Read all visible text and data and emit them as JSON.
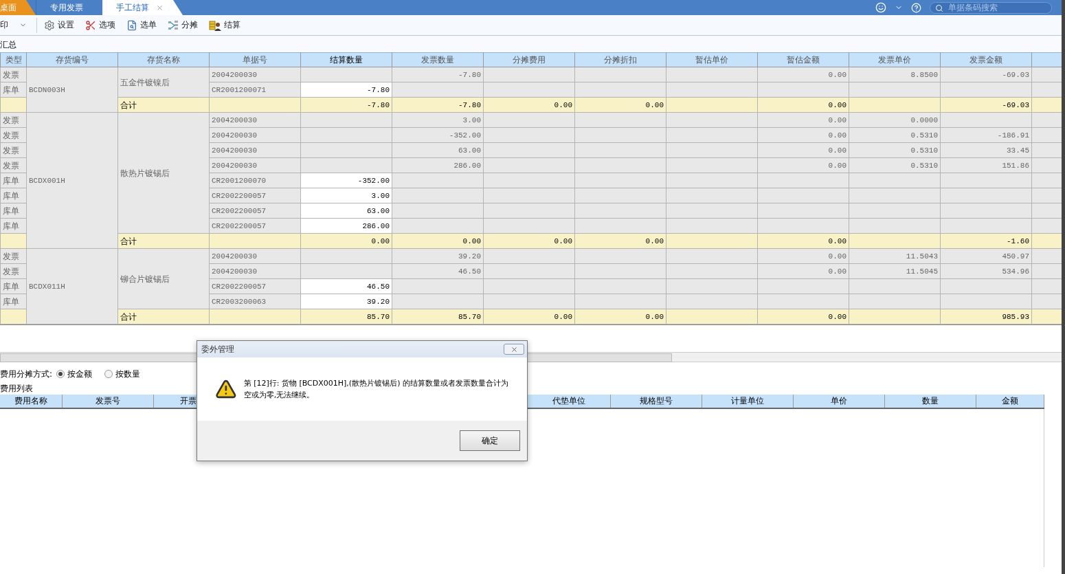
{
  "tabs": [
    {
      "label": "桌面",
      "kind": "home",
      "selected": false
    },
    {
      "label": "专用发票",
      "kind": "doc",
      "selected": false
    },
    {
      "label": "手工结算",
      "kind": "doc",
      "selected": true
    }
  ],
  "search": {
    "placeholder": "单据条码搜索"
  },
  "toolbar": [
    {
      "label": "印",
      "kind": "print"
    },
    {
      "label": "设置",
      "kind": "gear"
    },
    {
      "label": "选项",
      "kind": "tools"
    },
    {
      "label": "选单",
      "kind": "pick"
    },
    {
      "label": "分摊",
      "kind": "split"
    },
    {
      "label": "结算",
      "kind": "settle"
    }
  ],
  "section_title": "汇总",
  "grid": {
    "columns": [
      {
        "label": "类型",
        "editable": false
      },
      {
        "label": "存货编号",
        "editable": false
      },
      {
        "label": "存货名称",
        "editable": false
      },
      {
        "label": "单据号",
        "editable": false
      },
      {
        "label": "结算数量",
        "editable": true
      },
      {
        "label": "发票数量",
        "editable": false
      },
      {
        "label": "分摊费用",
        "editable": false
      },
      {
        "label": "分摊折扣",
        "editable": false
      },
      {
        "label": "暂估单价",
        "editable": false
      },
      {
        "label": "暂估金额",
        "editable": false
      },
      {
        "label": "发票单价",
        "editable": false
      },
      {
        "label": "发票金额",
        "editable": false
      }
    ],
    "groups": [
      {
        "code": "BCDN003H",
        "name": "五金件镀镍后",
        "rows": [
          {
            "kind": "invoice",
            "type": "发票",
            "doc": "2004200030",
            "cells": [
              null,
              "-7.80",
              null,
              null,
              null,
              "0.00",
              "8.8500",
              "-69.03"
            ]
          },
          {
            "kind": "receipt",
            "type": "库单",
            "doc": "CR2001200071",
            "cells": [
              "-7.80",
              null,
              null,
              null,
              null,
              null,
              null,
              null
            ]
          }
        ],
        "total": {
          "label": "合计",
          "cells": [
            "-7.80",
            "-7.80",
            "0.00",
            "0.00",
            null,
            "0.00",
            null,
            "-69.03"
          ]
        }
      },
      {
        "code": "BCDX001H",
        "name": "散热片镀锡后",
        "rows": [
          {
            "kind": "invoice",
            "type": "发票",
            "doc": "2004200030",
            "cells": [
              null,
              "3.00",
              null,
              null,
              null,
              "0.00",
              "0.0000",
              null
            ]
          },
          {
            "kind": "invoice",
            "type": "发票",
            "doc": "2004200030",
            "cells": [
              null,
              "-352.00",
              null,
              null,
              null,
              "0.00",
              "0.5310",
              "-186.91"
            ]
          },
          {
            "kind": "invoice",
            "type": "发票",
            "doc": "2004200030",
            "cells": [
              null,
              "63.00",
              null,
              null,
              null,
              "0.00",
              "0.5310",
              "33.45"
            ]
          },
          {
            "kind": "invoice",
            "type": "发票",
            "doc": "2004200030",
            "cells": [
              null,
              "286.00",
              null,
              null,
              null,
              "0.00",
              "0.5310",
              "151.86"
            ]
          },
          {
            "kind": "receipt",
            "type": "库单",
            "doc": "CR2001200070",
            "cells": [
              "-352.00",
              null,
              null,
              null,
              null,
              null,
              null,
              null
            ]
          },
          {
            "kind": "receipt",
            "type": "库单",
            "doc": "CR2002200057",
            "cells": [
              "3.00",
              null,
              null,
              null,
              null,
              null,
              null,
              null
            ]
          },
          {
            "kind": "receipt",
            "type": "库单",
            "doc": "CR2002200057",
            "cells": [
              "63.00",
              null,
              null,
              null,
              null,
              null,
              null,
              null
            ]
          },
          {
            "kind": "receipt",
            "type": "库单",
            "doc": "CR2002200057",
            "cells": [
              "286.00",
              null,
              null,
              null,
              null,
              null,
              null,
              null
            ]
          }
        ],
        "total": {
          "label": "合计",
          "cells": [
            "0.00",
            "0.00",
            "0.00",
            "0.00",
            null,
            "0.00",
            null,
            "-1.60"
          ]
        }
      },
      {
        "code": "BCDX011H",
        "name": "铆合片镀锡后",
        "rows": [
          {
            "kind": "invoice",
            "type": "发票",
            "doc": "2004200030",
            "cells": [
              null,
              "39.20",
              null,
              null,
              null,
              "0.00",
              "11.5043",
              "450.97"
            ]
          },
          {
            "kind": "invoice",
            "type": "发票",
            "doc": "2004200030",
            "cells": [
              null,
              "46.50",
              null,
              null,
              null,
              "0.00",
              "11.5045",
              "534.96"
            ]
          },
          {
            "kind": "receipt",
            "type": "库单",
            "doc": "CR2002200057",
            "cells": [
              "46.50",
              null,
              null,
              null,
              null,
              null,
              null,
              null
            ]
          },
          {
            "kind": "receipt",
            "type": "库单",
            "doc": "CR2003200063",
            "cells": [
              "39.20",
              null,
              null,
              null,
              null,
              null,
              null,
              null
            ]
          }
        ],
        "total": {
          "label": "合计",
          "cells": [
            "85.70",
            "85.70",
            "0.00",
            "0.00",
            null,
            "0.00",
            null,
            "985.93"
          ]
        }
      }
    ]
  },
  "allocation": {
    "label": "费用分摊方式:",
    "options": [
      {
        "label": "按金额",
        "selected": true
      },
      {
        "label": "按数量",
        "selected": false
      }
    ]
  },
  "fee_list": {
    "title": "费用列表",
    "columns": [
      "费用名称",
      "发票号",
      "开票",
      "代垫单位",
      "规格型号",
      "计量单位",
      "单价",
      "数量",
      "金额"
    ]
  },
  "dialog": {
    "title": "委外管理",
    "message": "第 [12]行: 货物 [BCDX001H],(散热片镀锡后) 的结算数量或者发票数量合计为空或为零,无法继续。",
    "button": "确定"
  }
}
